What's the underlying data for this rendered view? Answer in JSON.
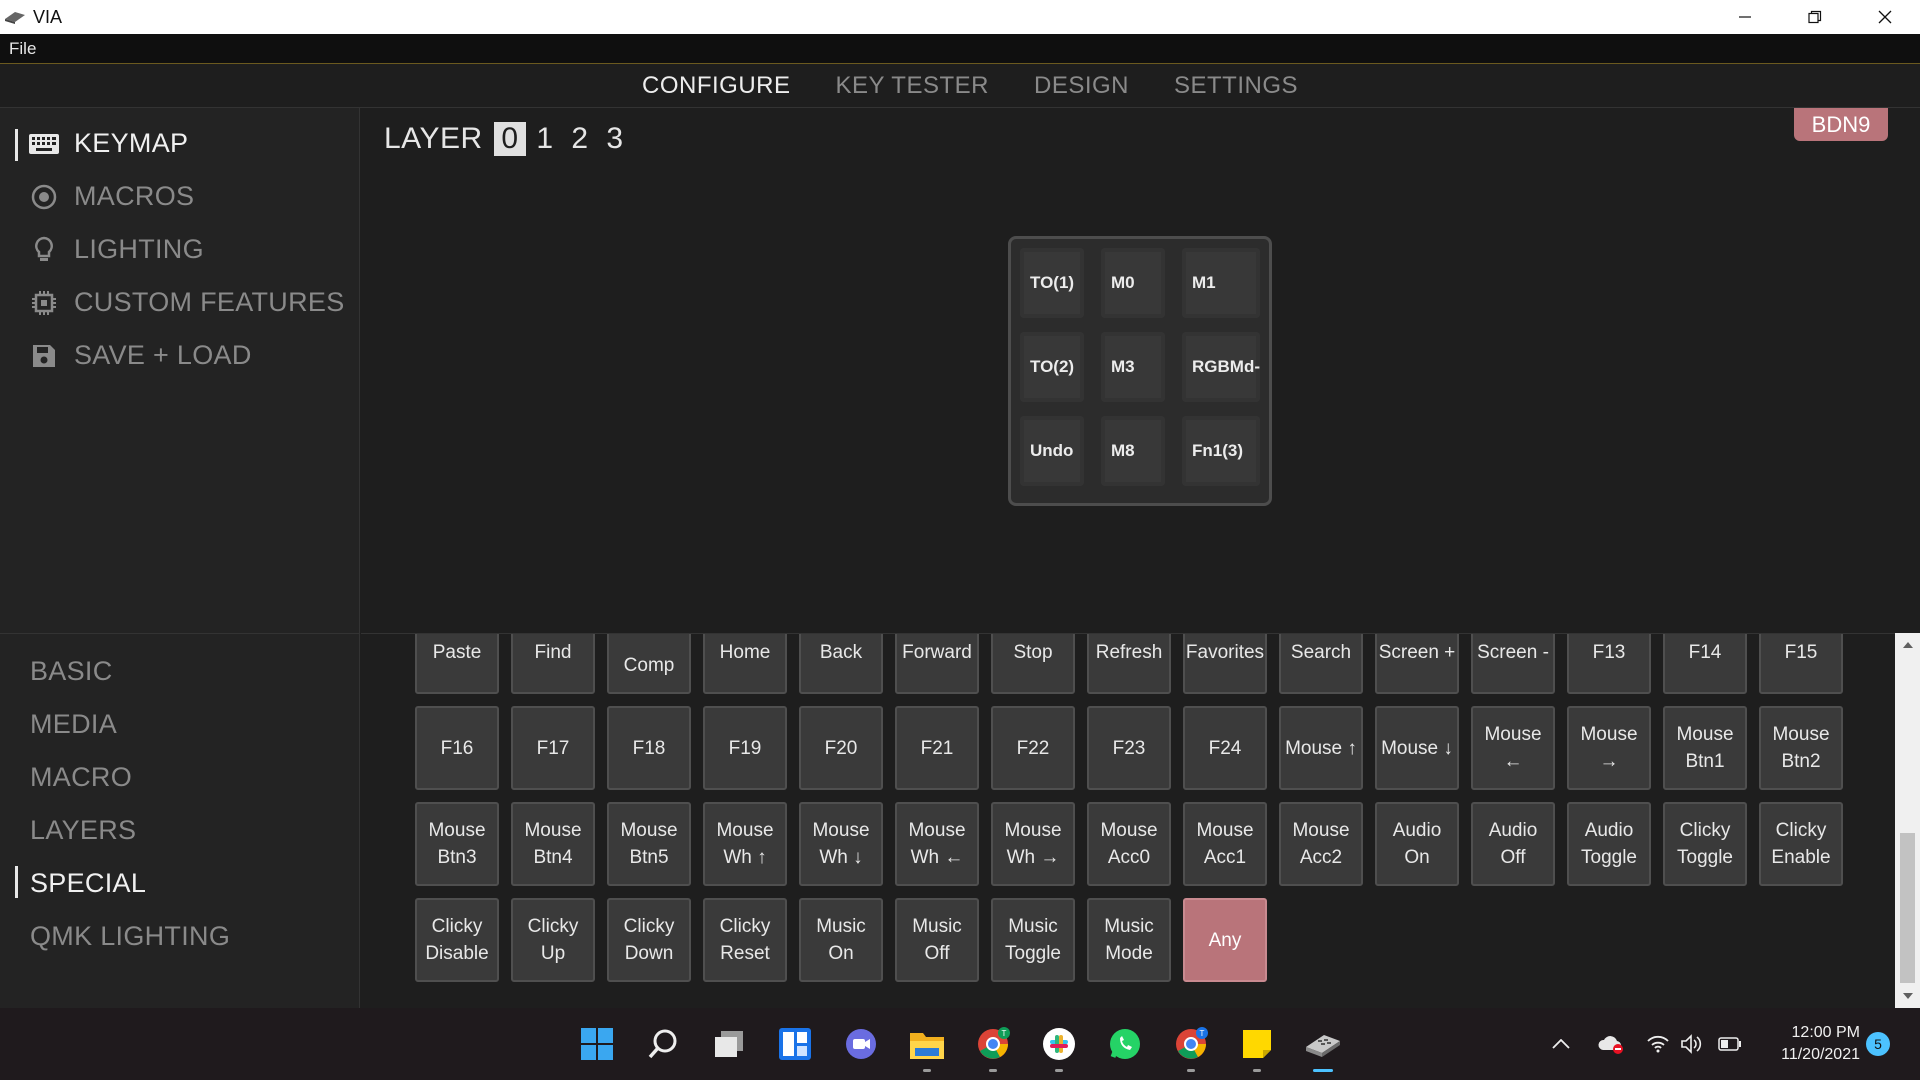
{
  "window": {
    "title": "VIA"
  },
  "menubar": {
    "file": "File"
  },
  "nav": {
    "tabs": [
      "CONFIGURE",
      "KEY TESTER",
      "DESIGN",
      "SETTINGS"
    ]
  },
  "leftmenu": {
    "items": [
      "KEYMAP",
      "MACROS",
      "LIGHTING",
      "CUSTOM FEATURES",
      "SAVE + LOAD"
    ]
  },
  "keymap": {
    "layer_label": "LAYER",
    "layers": [
      "0",
      "1",
      "2",
      "3"
    ],
    "selected_layer": "0",
    "device": "BDN9",
    "keys": [
      "TO(1)",
      "M0",
      "M1",
      "TO(2)",
      "M3",
      "RGBMd-",
      "Undo",
      "M8",
      "Fn1(3)"
    ]
  },
  "categories": {
    "items": [
      "BASIC",
      "MEDIA",
      "MACRO",
      "LAYERS",
      "SPECIAL",
      "QMK LIGHTING"
    ],
    "active": "SPECIAL"
  },
  "palette": {
    "rows": [
      [
        "Paste",
        "Find",
        "\nComp",
        "Home",
        "Back",
        "Forward",
        "Stop",
        "Refresh",
        "Favorites",
        "Search",
        "Screen +",
        "Screen -",
        "F13",
        "F14",
        "F15"
      ],
      [
        "F16",
        "F17",
        "F18",
        "F19",
        "F20",
        "F21",
        "F22",
        "F23",
        "F24",
        "Mouse ↑",
        "Mouse ↓",
        "Mouse\n←",
        "Mouse\n→",
        "Mouse\nBtn1",
        "Mouse\nBtn2"
      ],
      [
        "Mouse\nBtn3",
        "Mouse\nBtn4",
        "Mouse\nBtn5",
        "Mouse\nWh ↑",
        "Mouse\nWh ↓",
        "Mouse\nWh ←",
        "Mouse\nWh →",
        "Mouse\nAcc0",
        "Mouse\nAcc1",
        "Mouse\nAcc2",
        "Audio\nOn",
        "Audio\nOff",
        "Audio\nToggle",
        "Clicky\nToggle",
        "Clicky\nEnable"
      ],
      [
        "Clicky\nDisable",
        "Clicky\nUp",
        "Clicky\nDown",
        "Clicky\nReset",
        "Music\nOn",
        "Music\nOff",
        "Music\nToggle",
        "Music\nMode",
        "Any"
      ]
    ]
  },
  "taskbar": {
    "clock_time": "12:00 PM",
    "clock_date": "11/20/2021",
    "notification_count": "5",
    "icons": [
      "windows-start-icon",
      "search-icon",
      "task-view-icon",
      "widgets-icon",
      "teams-chat-icon",
      "file-explorer-icon",
      "chrome-icon",
      "slack-icon",
      "whatsapp-icon",
      "chrome-profile-icon",
      "sticky-notes-icon",
      "via-icon"
    ]
  },
  "colors": {
    "accent": "#b9747a",
    "background": "#1e1e1e",
    "panel": "#232323",
    "taskbar": "#1f1a1d"
  }
}
